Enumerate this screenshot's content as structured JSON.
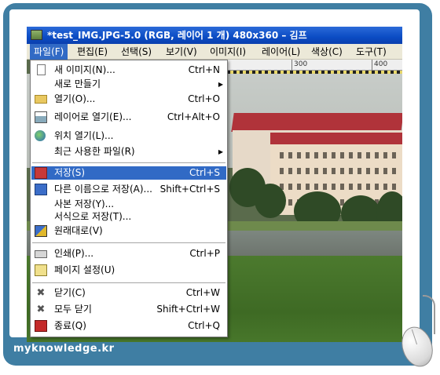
{
  "window": {
    "title": "*test_IMG.JPG-5.0 (RGB, 레이어 1 개) 480x360 – 김프"
  },
  "menubar": {
    "items": [
      {
        "label": "파일(F)",
        "active": true
      },
      {
        "label": "편집(E)",
        "active": false
      },
      {
        "label": "선택(S)",
        "active": false
      },
      {
        "label": "보기(V)",
        "active": false
      },
      {
        "label": "이미지(I)",
        "active": false
      },
      {
        "label": "레이어(L)",
        "active": false
      },
      {
        "label": "색상(C)",
        "active": false
      },
      {
        "label": "도구(T)",
        "active": false
      }
    ]
  },
  "ruler": {
    "ticks": [
      "300",
      "400"
    ]
  },
  "file_menu": {
    "items": [
      {
        "label": "새 이미지(N)...",
        "shortcut": "Ctrl+N",
        "icon": "new-image-icon"
      },
      {
        "label": "새로 만들기",
        "shortcut": "",
        "icon": "",
        "submenu": true
      },
      {
        "label": "열기(O)...",
        "shortcut": "Ctrl+O",
        "icon": "open-folder-icon"
      },
      {
        "label": "레이어로 열기(E)...",
        "shortcut": "Ctrl+Alt+O",
        "icon": "open-as-layer-icon"
      },
      {
        "label": "위치 열기(L)...",
        "shortcut": "",
        "icon": "globe-icon"
      },
      {
        "label": "최근 사용한 파일(R)",
        "shortcut": "",
        "icon": "",
        "submenu": true
      },
      {
        "label": "저장(S)",
        "shortcut": "Ctrl+S",
        "icon": "save-icon",
        "highlighted": true
      },
      {
        "label": "다른 이름으로 저장(A)...",
        "shortcut": "Shift+Ctrl+S",
        "icon": "save-as-icon"
      },
      {
        "label": "사본 저장(Y)...",
        "shortcut": "",
        "icon": ""
      },
      {
        "label": "서식으로 저장(T)...",
        "shortcut": "",
        "icon": ""
      },
      {
        "label": "원래대로(V)",
        "shortcut": "",
        "icon": "revert-icon"
      },
      {
        "label": "인쇄(P)...",
        "shortcut": "Ctrl+P",
        "icon": "print-icon"
      },
      {
        "label": "페이지 설정(U)",
        "shortcut": "",
        "icon": "page-setup-icon"
      },
      {
        "label": "닫기(C)",
        "shortcut": "Ctrl+W",
        "icon": "close-icon"
      },
      {
        "label": "모두 닫기",
        "shortcut": "Shift+Ctrl+W",
        "icon": "close-all-icon"
      },
      {
        "label": "종료(Q)",
        "shortcut": "Ctrl+Q",
        "icon": "quit-icon"
      }
    ]
  },
  "watermark": {
    "text": "myknowledge.kr"
  },
  "colors": {
    "frame": "#3f7ea3",
    "titlebar": "#0b4cc4",
    "highlight": "#316ac5",
    "menubar": "#ece9d8"
  }
}
